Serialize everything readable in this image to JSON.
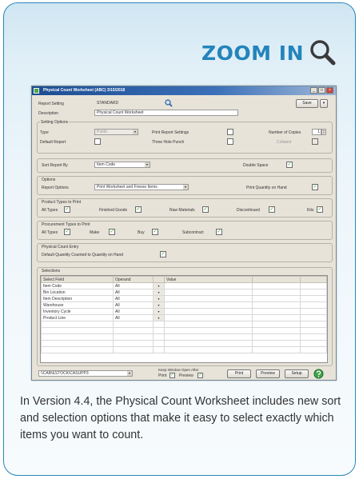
{
  "header": {
    "zoom_label": "ZOOM IN",
    "accent_color": "#2484bb",
    "icon": "magnifier-icon"
  },
  "window": {
    "title": "Physical Count Worksheet (ABC) 3/15/2018",
    "controls": {
      "minimize": "_",
      "maximize": "□",
      "close": "×"
    }
  },
  "top": {
    "report_setting_label": "Report Setting",
    "report_setting_value": "STANDARD",
    "description_label": "Description",
    "description_value": "Physical Count Worksheet",
    "save_label": "Save"
  },
  "setting_options": {
    "title": "Setting Options",
    "type_label": "Type",
    "type_value": "Public",
    "default_report_label": "Default Report",
    "print_report_settings_label": "Print Report Settings",
    "three_hole_punch_label": "Three Hole Punch",
    "number_of_copies_label": "Number of Copies",
    "number_of_copies_value": "1",
    "collated_label": "Collated"
  },
  "sort": {
    "sort_report_by_label": "Sort Report By",
    "sort_report_by_value": "Item Code",
    "double_space_label": "Double Space"
  },
  "options": {
    "title": "Options",
    "report_options_label": "Report Options",
    "report_options_value": "Print Worksheet and Freeze Items",
    "print_quantity_label": "Print Quantity on Hand"
  },
  "product_types": {
    "title": "Product Types to Print",
    "items": [
      "All Types",
      "Finished Goods",
      "Raw Materials",
      "Discontinued",
      "Kits"
    ]
  },
  "procurement_types": {
    "title": "Procurement Types to Print",
    "items": [
      "All Types",
      "Make",
      "Buy",
      "Subcontract"
    ]
  },
  "count_entry": {
    "title": "Physical Count Entry",
    "default_label": "Default Quantity Counted to Quantity on Hand"
  },
  "selections": {
    "title": "Selections",
    "columns": [
      "Select Field",
      "Operand",
      "Value"
    ],
    "rows": [
      {
        "field": "Item Code",
        "operand": "All"
      },
      {
        "field": "Bin Location",
        "operand": "All"
      },
      {
        "field": "Item Description",
        "operand": "All"
      },
      {
        "field": "Warehouse",
        "operand": "All"
      },
      {
        "field": "Inventory Cycle",
        "operand": "All"
      },
      {
        "field": "Product Line",
        "operand": "All"
      }
    ]
  },
  "footer": {
    "printer": "\\\\CAB\\ESTOCK\\CASUPP3",
    "keep_window_label": "Keep Window Open After",
    "print_label": "Print",
    "preview_label": "Preview",
    "print_button": "Print",
    "preview_button": "Preview",
    "setup_button": "Setup"
  },
  "caption": "In Version 4.4, the Physical Count Worksheet includes new sort and selection options that make it easy to select exactly which items you want to count."
}
